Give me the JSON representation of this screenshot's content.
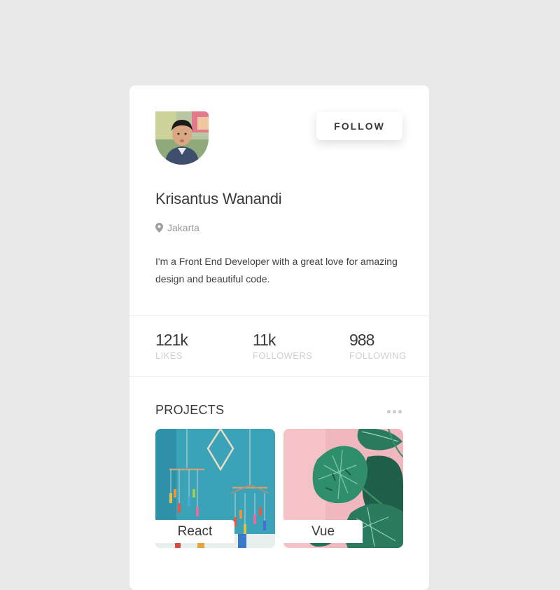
{
  "profile": {
    "name": "Krisantus Wanandi",
    "location": "Jakarta",
    "bio": "I'm a Front End Developer with a great love for amazing design and beautiful code.",
    "follow_label": "FOLLOW"
  },
  "stats": [
    {
      "value": "121k",
      "label": "LIKES"
    },
    {
      "value": "11k",
      "label": "FOLLOWERS"
    },
    {
      "value": "988",
      "label": "FOLLOWING"
    }
  ],
  "projects": {
    "title": "PROJECTS",
    "items": [
      {
        "label": "React",
        "image": "wind-chime-mobiles-on-teal-wall"
      },
      {
        "label": "Vue",
        "image": "monstera-leaves-on-pink-wall"
      }
    ]
  },
  "icons": {
    "location": "map-pin-icon",
    "more": "more-horizontal-dots-icon"
  },
  "colors": {
    "page_background": "#e9e9e9",
    "card_background": "#ffffff",
    "text_primary": "#3a3a3a",
    "text_muted": "#cfcfcf"
  }
}
